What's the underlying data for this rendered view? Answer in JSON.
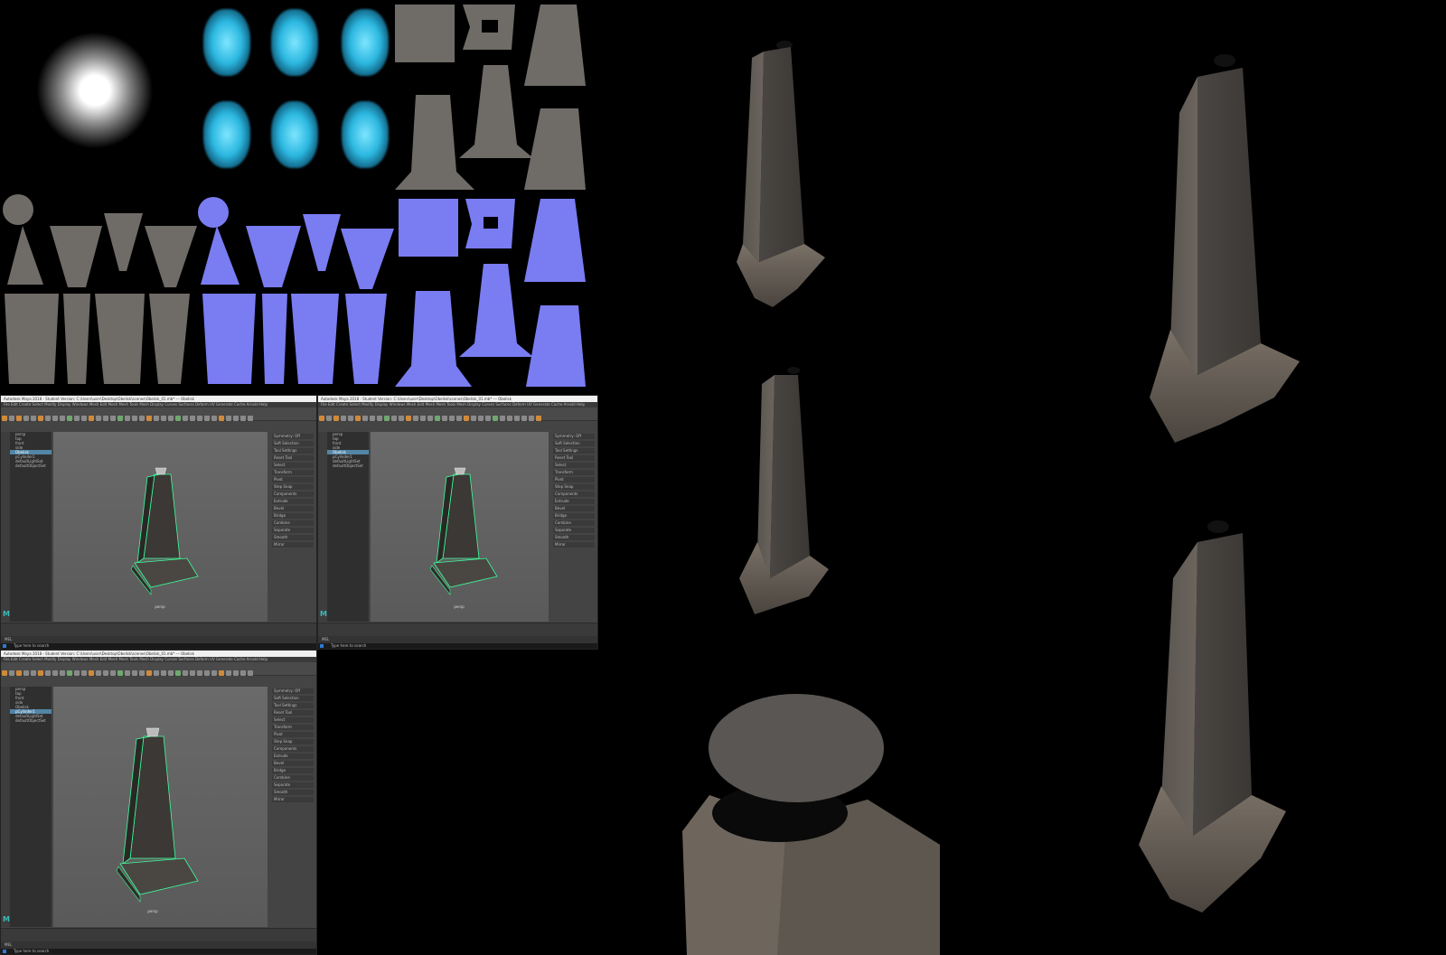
{
  "maya_windows": [
    {
      "title": "Autodesk Maya 2018 - Student Version: C:\\Users\\user\\Desktop\\Obelisk\\scenes\\Obelisk_01.mb* --- Obelisk",
      "menu": "File  Edit  Create  Select  Modify  Display  Windows  Mesh  Edit Mesh  Mesh Tools  Mesh Display  Curves  Surfaces  Deform  UV  Generate  Cache  Arnold  Help",
      "outliner_items": [
        "persp",
        "top",
        "front",
        "side",
        "Obelisk",
        "pCylinder1",
        "defaultLightSet",
        "defaultObjectSet"
      ],
      "selected_index": 4,
      "attr_rows": [
        "Symmetry: Off",
        "Soft Selection",
        "Tool Settings",
        "Reset Tool",
        "Select",
        "Transform",
        "Pivot",
        "Step Snap",
        "Components",
        "Extrude",
        "Bevel",
        "Bridge",
        "Combine",
        "Separate",
        "Smooth",
        "Mirror"
      ],
      "viewport_label": "persp",
      "command": "MEL",
      "taskbar_search": "Type here to search"
    },
    {
      "title": "Autodesk Maya 2018 - Student Version: C:\\Users\\user\\Desktop\\Obelisk\\scenes\\Obelisk_01.mb* --- Obelisk",
      "menu": "File  Edit  Create  Select  Modify  Display  Windows  Mesh  Edit Mesh  Mesh Tools  Mesh Display  Curves  Surfaces  Deform  UV  Generate  Cache  Arnold  Help",
      "outliner_items": [
        "persp",
        "top",
        "front",
        "side",
        "Obelisk",
        "pCylinder1",
        "defaultLightSet",
        "defaultObjectSet"
      ],
      "selected_index": 4,
      "attr_rows": [
        "Symmetry: Off",
        "Soft Selection",
        "Tool Settings",
        "Reset Tool",
        "Select",
        "Transform",
        "Pivot",
        "Step Snap",
        "Components",
        "Extrude",
        "Bevel",
        "Bridge",
        "Combine",
        "Separate",
        "Smooth",
        "Mirror"
      ],
      "viewport_label": "persp",
      "command": "MEL",
      "taskbar_search": "Type here to search"
    },
    {
      "title": "Autodesk Maya 2018 - Student Version: C:\\Users\\user\\Desktop\\Obelisk\\scenes\\Obelisk_01.mb* --- Obelisk",
      "menu": "File  Edit  Create  Select  Modify  Display  Windows  Mesh  Edit Mesh  Mesh Tools  Mesh Display  Curves  Surfaces  Deform  UV  Generate  Cache  Arnold  Help",
      "outliner_items": [
        "persp",
        "top",
        "front",
        "side",
        "Obelisk",
        "pCylinder1",
        "defaultLightSet",
        "defaultObjectSet"
      ],
      "selected_index": 5,
      "attr_rows": [
        "Symmetry: Off",
        "Soft Selection",
        "Tool Settings",
        "Reset Tool",
        "Select",
        "Transform",
        "Pivot",
        "Step Snap",
        "Components",
        "Extrude",
        "Bevel",
        "Bridge",
        "Combine",
        "Separate",
        "Smooth",
        "Mirror"
      ],
      "viewport_label": "persp",
      "command": "MEL",
      "taskbar_search": "Type here to search"
    }
  ],
  "colors": {
    "background": "#000000",
    "stone": "#6f6c68",
    "normal_map": "#7a7cf2",
    "wisp": "#2bb7e0",
    "wireframe": "#3cff9a",
    "maya_bg": "#444444",
    "maya_selection": "#5285a6"
  }
}
